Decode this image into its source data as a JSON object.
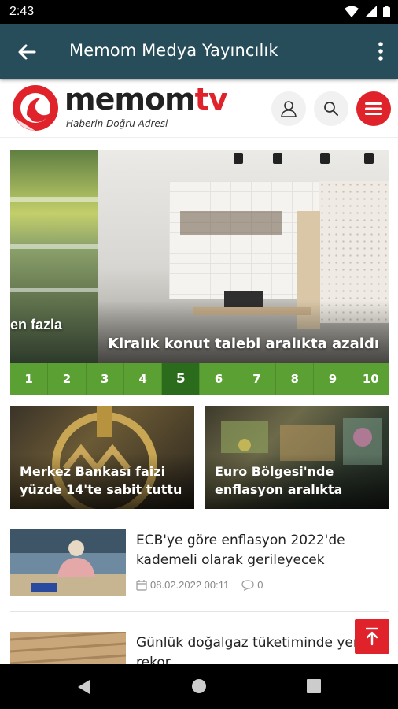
{
  "status_bar": {
    "time": "2:43"
  },
  "app_bar": {
    "title": "Memom Medya Yayıncılık"
  },
  "site_header": {
    "logo_text_main": "memom",
    "logo_text_accent": "tv",
    "tagline": "Haberin Doğru Adresi"
  },
  "slider": {
    "prev_caption": "en fazla",
    "caption": "Kiralık konut talebi aralıkta azaldı",
    "pages": [
      "1",
      "2",
      "3",
      "4",
      "5",
      "6",
      "7",
      "8",
      "9",
      "10"
    ],
    "active_page": "5"
  },
  "cards": [
    {
      "line1": "Merkez Bankası faizi",
      "line2": "yüzde 14'te sabit tuttu"
    },
    {
      "line1": "Euro Bölgesi'nde",
      "line2": "enflasyon aralıkta"
    }
  ],
  "news": [
    {
      "line1": "ECB'ye göre enflasyon 2022'de",
      "line2": "kademeli olarak gerileyecek",
      "date": "08.02.2022 00:11",
      "comments": "0"
    },
    {
      "line1": "Günlük doğalgaz tüketiminde yeni",
      "line2": "rekor"
    }
  ],
  "colors": {
    "brand_red": "#e0232b",
    "appbar": "#264d59",
    "pager_green": "#5aa033",
    "pager_active": "#2b6b1c"
  }
}
